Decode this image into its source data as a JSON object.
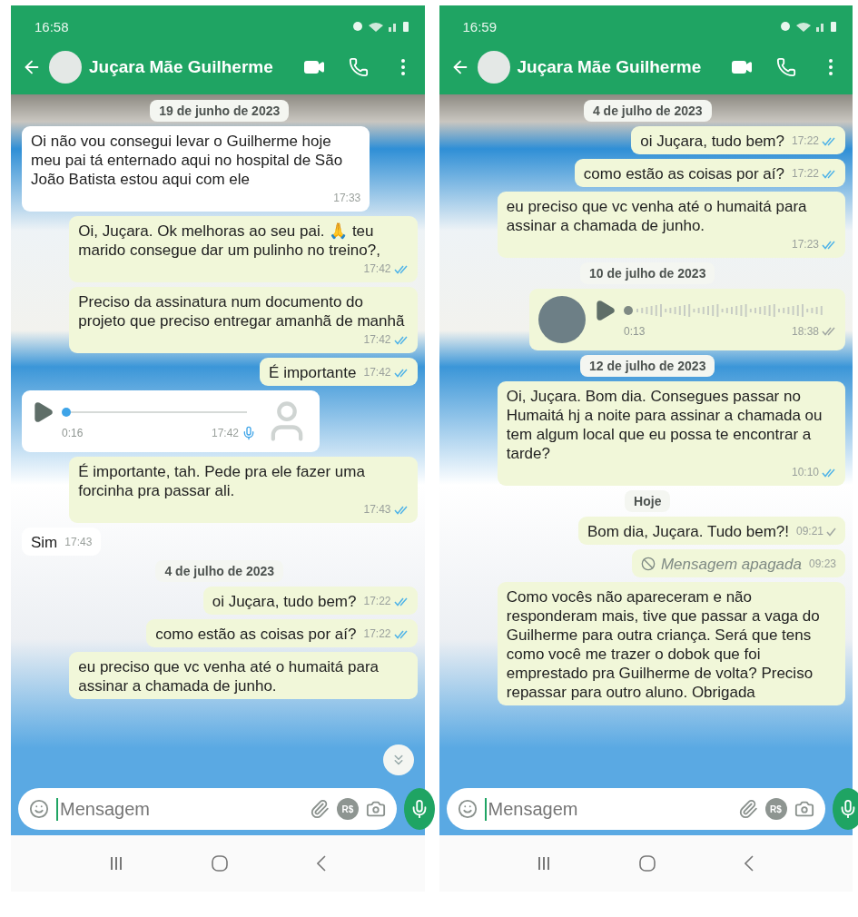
{
  "screens": [
    {
      "status_bar": {
        "time": "16:58"
      },
      "header": {
        "title": "Juçara Mãe Guilherme"
      },
      "scroll_down_button": true,
      "messages": [
        {
          "kind": "date",
          "text": "19 de junho de 2023"
        },
        {
          "kind": "text",
          "outgoing": false,
          "text": "Oi não vou consegui levar o Guilherme hoje meu pai tá enternado aqui no hospital de São João Batista estou aqui com ele",
          "time": "17:33"
        },
        {
          "kind": "text",
          "outgoing": true,
          "text": "Oi, Juçara. Ok melhoras ao seu pai. 🙏 teu marido consegue dar um pulinho no treino?,",
          "time": "17:42",
          "double_tick": true,
          "read": true
        },
        {
          "kind": "text",
          "outgoing": true,
          "text": "Preciso da assinatura num documento do projeto que preciso entregar amanhã de manhã",
          "time": "17:42",
          "double_tick": true,
          "read": true
        },
        {
          "kind": "text",
          "outgoing": true,
          "text": "É importante",
          "time": "17:42",
          "double_tick": true,
          "read": true
        },
        {
          "kind": "voice",
          "outgoing": false,
          "duration": "0:16",
          "time": "17:42",
          "level": 0
        },
        {
          "kind": "text",
          "outgoing": true,
          "text": "É importante, tah. Pede pra ele fazer uma forcinha pra passar ali.",
          "time": "17:43",
          "double_tick": true,
          "read": true
        },
        {
          "kind": "text",
          "outgoing": false,
          "text": "Sim",
          "time": "17:43"
        },
        {
          "kind": "date",
          "text": "4 de julho de 2023"
        },
        {
          "kind": "text",
          "outgoing": true,
          "text": "oi Juçara, tudo bem?",
          "time": "17:22",
          "double_tick": true,
          "read": true
        },
        {
          "kind": "text",
          "outgoing": true,
          "text": "como estão as coisas por aí?",
          "time": "17:22",
          "double_tick": true,
          "read": true
        },
        {
          "kind": "text",
          "outgoing": true,
          "text": "eu preciso que vc venha até o humaitá para assinar a chamada de junho."
        }
      ],
      "composer": {
        "placeholder": "Mensagem",
        "currency_label": "R$"
      }
    },
    {
      "status_bar": {
        "time": "16:59"
      },
      "header": {
        "title": "Juçara Mãe Guilherme"
      },
      "messages": [
        {
          "kind": "date",
          "text": "4 de julho de 2023"
        },
        {
          "kind": "text",
          "outgoing": true,
          "text": "oi Juçara, tudo bem?",
          "time": "17:22",
          "double_tick": true,
          "read": true
        },
        {
          "kind": "text",
          "outgoing": true,
          "text": "como estão as coisas por aí?",
          "time": "17:22",
          "double_tick": true,
          "read": true
        },
        {
          "kind": "text",
          "outgoing": true,
          "text": "eu preciso que vc venha até o humaitá para assinar a chamada de junho.",
          "time": "17:23",
          "double_tick": true,
          "read": true
        },
        {
          "kind": "date",
          "text": "10 de julho de 2023"
        },
        {
          "kind": "voice",
          "outgoing": true,
          "duration": "0:13",
          "time": "18:38",
          "level": 0,
          "double_tick": true,
          "read": false
        },
        {
          "kind": "date",
          "text": "12 de julho de 2023"
        },
        {
          "kind": "text",
          "outgoing": true,
          "text": "Oi, Juçara. Bom dia. Consegues passar no Humaitá hj a noite para assinar a chamada ou tem algum local que eu possa te encontrar a tarde?",
          "time": "10:10",
          "double_tick": true,
          "read": true
        },
        {
          "kind": "date",
          "text": "Hoje"
        },
        {
          "kind": "text",
          "outgoing": true,
          "text": "Bom dia, Juçara. Tudo bem?!",
          "time": "09:21",
          "double_tick": false,
          "read": false
        },
        {
          "kind": "deleted",
          "outgoing": true,
          "text": "Mensagem apagada",
          "time": "09:23"
        },
        {
          "kind": "text",
          "outgoing": true,
          "text": "Como vocês não apareceram e não responderam mais, tive que passar a vaga do Guilherme para outra criança. Será que tens como você me trazer o dobok que foi emprestado pra Guilherme de volta? Preciso repassar para outro aluno. Obrigada"
        }
      ],
      "composer": {
        "placeholder": "Mensagem",
        "currency_label": "R$"
      }
    }
  ]
}
